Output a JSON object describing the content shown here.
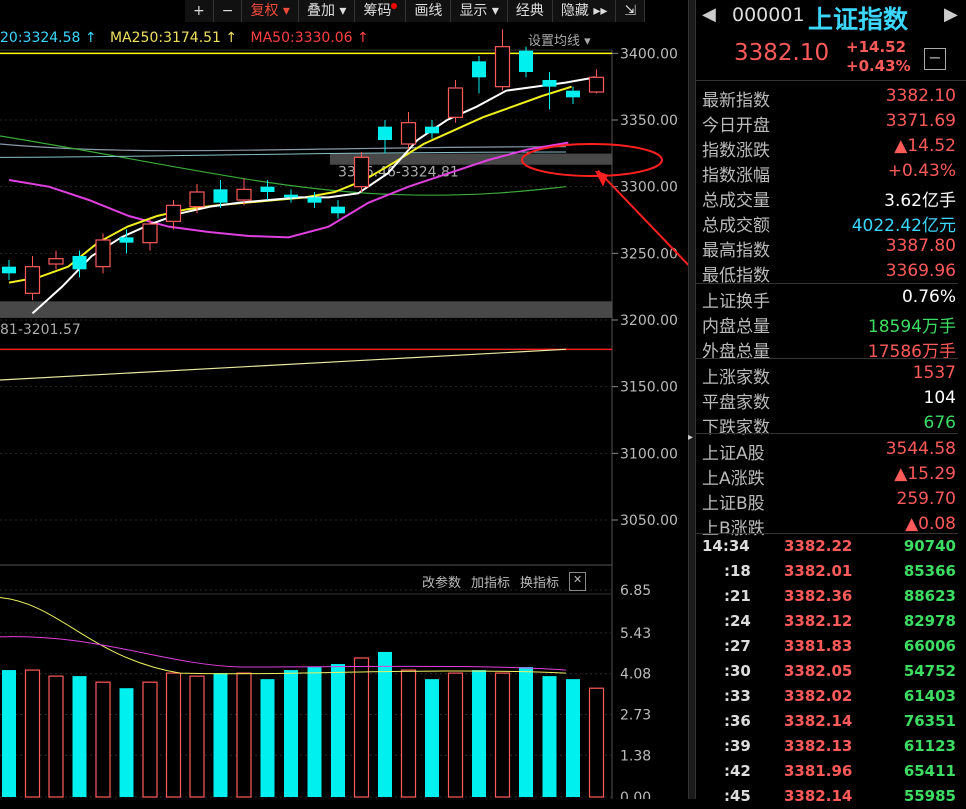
{
  "toolbar": {
    "plus": "+",
    "minus": "−",
    "buttons": [
      "复权",
      "叠加",
      "筹码",
      "画线",
      "显示",
      "经典",
      "隐藏"
    ],
    "expand": "⇲"
  },
  "ma": {
    "ma20": "20:3324.58 ↑",
    "ma250": "MA250:3174.51 ↑",
    "ma50": "MA50:3330.06 ↑",
    "settings": "设置均线"
  },
  "price_axis": [
    "3400.00",
    "3350.00",
    "3300.00",
    "3250.00",
    "3200.00",
    "3150.00",
    "3100.00",
    "3050.00"
  ],
  "gap_labels": {
    "upper": "3316.46-3324.81",
    "lower": "81-3201.57"
  },
  "indicator": {
    "tools": [
      "改参数",
      "加指标",
      "换指标"
    ],
    "axis": [
      "6.85",
      "5.43",
      "4.08",
      "2.73",
      "1.38",
      "0.00"
    ]
  },
  "chart_data": {
    "type": "candlestick",
    "candles": [
      [
        3240,
        3235,
        3245,
        3230
      ],
      [
        3220,
        3240,
        3248,
        3215
      ],
      [
        3242,
        3246,
        3252,
        3238
      ],
      [
        3248,
        3238,
        3252,
        3232
      ],
      [
        3240,
        3260,
        3265,
        3235
      ],
      [
        3262,
        3258,
        3268,
        3250
      ],
      [
        3258,
        3272,
        3276,
        3252
      ],
      [
        3274,
        3286,
        3290,
        3268
      ],
      [
        3285,
        3296,
        3302,
        3280
      ],
      [
        3298,
        3288,
        3305,
        3284
      ],
      [
        3290,
        3298,
        3306,
        3286
      ],
      [
        3300,
        3296,
        3305,
        3290
      ],
      [
        3294,
        3292,
        3298,
        3288
      ],
      [
        3292,
        3288,
        3296,
        3284
      ],
      [
        3285,
        3280,
        3290,
        3276
      ],
      [
        3300,
        3322,
        3326,
        3296
      ],
      [
        3345,
        3335,
        3350,
        3325
      ],
      [
        3332,
        3348,
        3356,
        3328
      ],
      [
        3345,
        3340,
        3350,
        3336
      ],
      [
        3352,
        3374,
        3380,
        3348
      ],
      [
        3394,
        3382,
        3398,
        3370
      ],
      [
        3375,
        3405,
        3418,
        3372
      ],
      [
        3402,
        3386,
        3405,
        3382
      ],
      [
        3380,
        3375,
        3386,
        3358
      ],
      [
        3372,
        3367,
        3375,
        3362
      ],
      [
        3371,
        3382,
        3388,
        3370
      ]
    ],
    "ma_white": [
      3205,
      3225,
      3248,
      3262,
      3272,
      3280,
      3285,
      3288,
      3290,
      3292,
      3292,
      3295,
      3310,
      3335,
      3350,
      3360,
      3372,
      3375,
      3378,
      3382
    ],
    "ma_yellow": [
      3228,
      3232,
      3240,
      3258,
      3270,
      3278,
      3283,
      3286,
      3288,
      3290,
      3292,
      3296,
      3305,
      3318,
      3332,
      3342,
      3352,
      3360,
      3368,
      3375
    ],
    "ma_magenta": [
      3305,
      3300,
      3290,
      3278,
      3270,
      3266,
      3263,
      3262,
      3270,
      3288,
      3300,
      3310,
      3320,
      3328,
      3333
    ],
    "volume": [
      4.2,
      4.2,
      4.0,
      4.0,
      3.8,
      3.6,
      3.8,
      4.1,
      4.0,
      4.1,
      4.1,
      3.9,
      4.2,
      4.3,
      4.4,
      4.6,
      4.8,
      4.2,
      3.9,
      4.1,
      4.2,
      4.1,
      4.3,
      4.0,
      3.9,
      3.6
    ],
    "price_range": [
      3020,
      3440
    ],
    "volume_range": [
      0,
      6.85
    ]
  },
  "quote": {
    "code": "000001",
    "name": "上证指数",
    "price": "3382.10",
    "change": "+14.52",
    "change_pct": "+0.43%",
    "stats": [
      {
        "label": "最新指数",
        "value": "3382.10",
        "color": "#ff5a5a"
      },
      {
        "label": "今日开盘",
        "value": "3371.69",
        "color": "#ff5a5a"
      },
      {
        "label": "指数涨跌",
        "value": "▲14.52",
        "color": "#ff5a5a"
      },
      {
        "label": "指数涨幅",
        "value": "+0.43%",
        "color": "#ff5a5a"
      },
      {
        "label": "总成交量",
        "value": "3.62亿手",
        "color": "#ffffff"
      },
      {
        "label": "总成交额",
        "value": "4022.42亿元",
        "color": "#3cd7ff"
      },
      {
        "label": "最高指数",
        "value": "3387.80",
        "color": "#ff5a5a"
      },
      {
        "label": "最低指数",
        "value": "3369.96",
        "color": "#ff5a5a"
      },
      {
        "label": "上证换手",
        "value": "0.76%",
        "color": "#ffffff"
      },
      {
        "label": "内盘总量",
        "value": "18594万手",
        "color": "#3ddc62"
      },
      {
        "label": "外盘总量",
        "value": "17586万手",
        "color": "#ff5a5a"
      },
      {
        "label": "上涨家数",
        "value": "1537",
        "color": "#ff5a5a"
      },
      {
        "label": "平盘家数",
        "value": "104",
        "color": "#ffffff"
      },
      {
        "label": "下跌家数",
        "value": "676",
        "color": "#3ddc62"
      },
      {
        "label": "上证A股",
        "value": "3544.58",
        "color": "#ff5a5a"
      },
      {
        "label": "上A涨跌",
        "value": "▲15.29",
        "color": "#ff5a5a"
      },
      {
        "label": "上证B股",
        "value": "259.70",
        "color": "#ff5a5a"
      },
      {
        "label": "上B涨跌",
        "value": "▲0.08",
        "color": "#ff5a5a"
      }
    ],
    "ticks": [
      {
        "time": "14:34",
        "price": "3382.22",
        "vol": "90740"
      },
      {
        "time": ":18",
        "price": "3382.01",
        "vol": "85366"
      },
      {
        "time": ":21",
        "price": "3382.36",
        "vol": "88623"
      },
      {
        "time": ":24",
        "price": "3382.12",
        "vol": "82978"
      },
      {
        "time": ":27",
        "price": "3381.83",
        "vol": "66006"
      },
      {
        "time": ":30",
        "price": "3382.05",
        "vol": "54752"
      },
      {
        "time": ":33",
        "price": "3382.02",
        "vol": "61403"
      },
      {
        "time": ":36",
        "price": "3382.14",
        "vol": "76351"
      },
      {
        "time": ":39",
        "price": "3382.13",
        "vol": "61123"
      },
      {
        "time": ":42",
        "price": "3381.96",
        "vol": "65411"
      },
      {
        "time": ":45",
        "price": "3382.14",
        "vol": "55985"
      }
    ]
  },
  "colors": {
    "up": "#ff5a5a",
    "down": "#00f0f0",
    "ma20": "#3cd7ff",
    "ma250": "#f0e060",
    "ma50": "#ff4040"
  }
}
